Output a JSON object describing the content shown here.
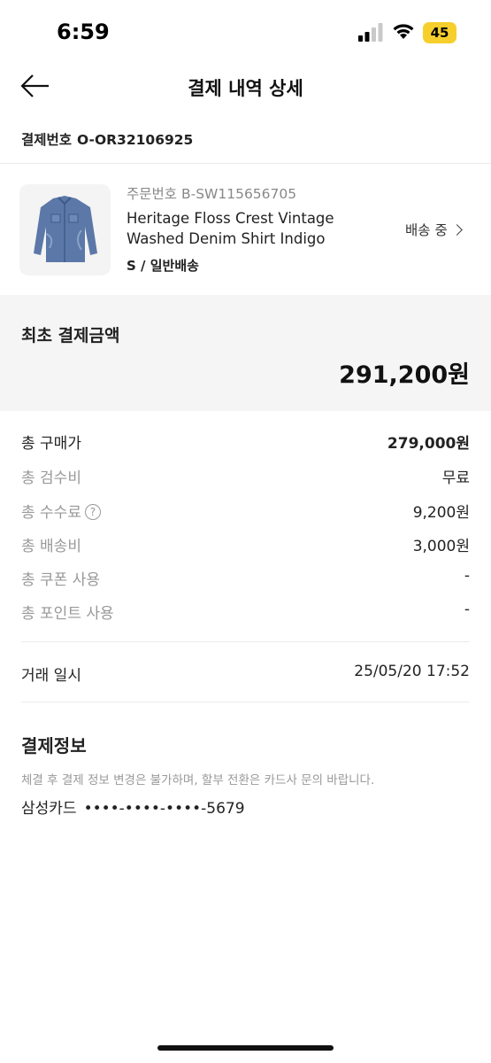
{
  "status_bar": {
    "time": "6:59",
    "battery": "45"
  },
  "header": {
    "title": "결제 내역 상세",
    "back_icon": "arrow-left-icon"
  },
  "payment_number": {
    "label": "결제번호",
    "value": "O-OR32106925"
  },
  "product": {
    "order_number": "주문번호 B-SW115656705",
    "name_line1": "Heritage Floss Crest Vintage",
    "name_line2": "Washed Denim Shirt Indigo",
    "option": "S / 일반배송",
    "status": "배송 중",
    "image": "denim-shirt-image"
  },
  "initial_payment": {
    "label": "최초 결제금액",
    "amount": "291,200원"
  },
  "breakdown": [
    {
      "label": "총 구매가",
      "value": "279,000원"
    },
    {
      "label": "총 검수비",
      "value": "무료"
    },
    {
      "label": "총 수수료",
      "value": "9,200원",
      "help_icon": "?"
    },
    {
      "label": "총 배송비",
      "value": "3,000원"
    },
    {
      "label": "총 쿠폰 사용",
      "value": "-"
    },
    {
      "label": "총 포인트 사용",
      "value": "-"
    }
  ],
  "transaction": {
    "label": "거래 일시",
    "value": "25/05/20 17:52"
  },
  "payment_info": {
    "title": "결제정보",
    "notice": "체결 후 결제 정보 변경은 불가하며, 할부 전환은 카드사 문의 바랍니다.",
    "card_name": "삼성카드",
    "card_number": "••••-••••-••••-5679"
  },
  "colors": {
    "battery": "#f6cf2c",
    "summary_bg": "#f5f5f5",
    "muted_text": "#999999"
  }
}
